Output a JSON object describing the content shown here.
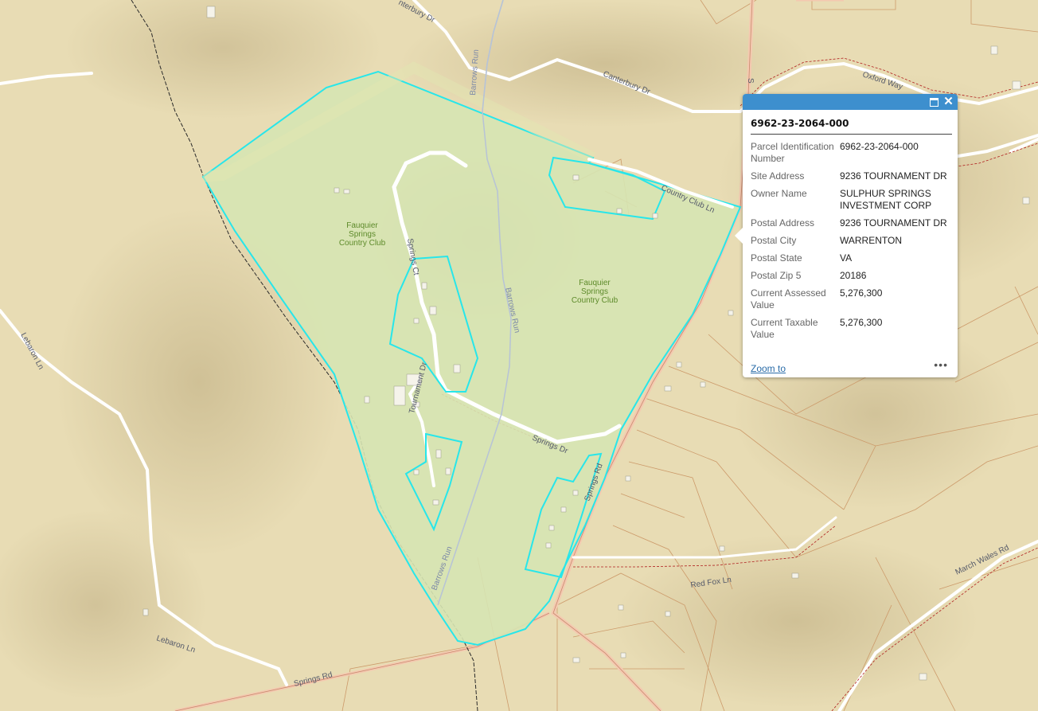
{
  "map": {
    "place_labels": [
      "Fauquier",
      "Springs",
      "Country Club"
    ],
    "road_labels": {
      "canterbury_dr_top": "nterbury Dr",
      "canterbury_dr": "Canterbury Dr",
      "oxford_way": "Oxford Way",
      "country_club_ln": "Country Club Ln",
      "barrows_run_1": "Barrows Run",
      "barrows_run_2": "Barrows Run",
      "barrows_run_3": "Barrows Run",
      "springs_ct": "Springs Ct",
      "tournament_dr": "Tournament Dr",
      "springs_dr": "Springs Dr",
      "springs_rd_east": "Springs Rd",
      "springs_rd_south": "Springs Rd",
      "lebaron_ln_1": "Lebaron Ln",
      "lebaron_ln_2": "Lebaron Ln",
      "march_wales_rd": "March Wales Rd",
      "red_fox_ln": "Red Fox Ln",
      "road_s": "S"
    },
    "colors": {
      "terrain": "#e8dcb4",
      "parcel_fill": "#d6e4b2",
      "highlight": "#27e6ea",
      "parcel_line": "#cc9a6a",
      "road": "#ffffff",
      "major_road": "#f4c9b0"
    }
  },
  "popup": {
    "title": "6962-23-2064-000",
    "fields": [
      {
        "label": "Parcel Identification Number",
        "value": "6962-23-2064-000"
      },
      {
        "label": "Site Address",
        "value": "9236 TOURNAMENT DR"
      },
      {
        "label": "Owner Name",
        "value": "SULPHUR SPRINGS INVESTMENT CORP"
      },
      {
        "label": "Postal Address",
        "value": "9236 TOURNAMENT DR"
      },
      {
        "label": "Postal City",
        "value": "WARRENTON"
      },
      {
        "label": "Postal State",
        "value": "VA"
      },
      {
        "label": "Postal Zip 5",
        "value": "20186"
      },
      {
        "label": "Current Assessed Value",
        "value": "5,276,300"
      },
      {
        "label": "Current Taxable Value",
        "value": "5,276,300"
      }
    ],
    "zoom_label": "Zoom to",
    "more_icon": "more-horizontal-icon",
    "maximize_icon": "maximize-icon",
    "close_icon": "close-icon"
  }
}
